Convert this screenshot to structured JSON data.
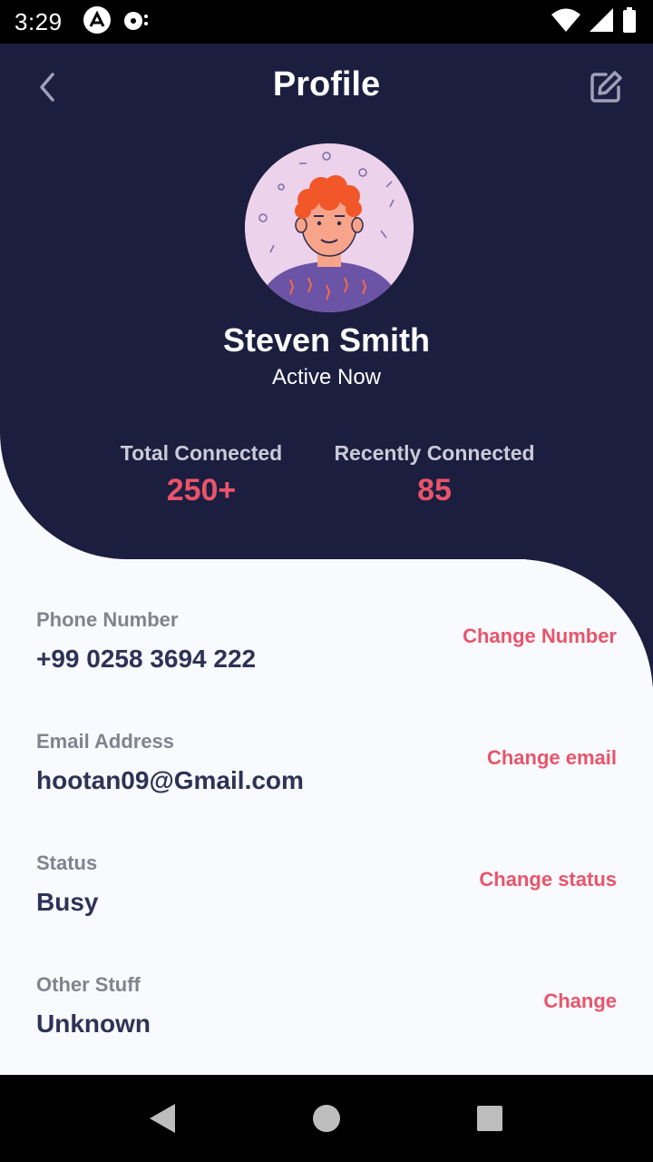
{
  "status_bar": {
    "time": "3:29",
    "icons": [
      "app-a-icon",
      "media-icon",
      "wifi-icon",
      "signal-icon",
      "battery-icon"
    ]
  },
  "header": {
    "title": "Profile",
    "back_icon": "chevron-left-icon",
    "edit_icon": "edit-icon"
  },
  "profile": {
    "name": "Steven Smith",
    "status": "Active Now",
    "avatar_icon": "avatar-illustration"
  },
  "stats": {
    "total_label": "Total Connected",
    "total_value": "250+",
    "recent_label": "Recently Connected",
    "recent_value": "85"
  },
  "info": [
    {
      "label": "Phone Number",
      "value": "+99 0258 3694 222",
      "action": "Change Number"
    },
    {
      "label": "Email Address",
      "value": "hootan09@Gmail.com",
      "action": "Change email"
    },
    {
      "label": "Status",
      "value": "Busy",
      "action": "Change status"
    },
    {
      "label": "Other Stuff",
      "value": "Unknown",
      "action": "Change"
    }
  ],
  "nav_bar": {
    "icons": [
      "back-triangle-icon",
      "home-circle-icon",
      "recents-square-icon"
    ]
  },
  "colors": {
    "header_bg": "#1b1e3f",
    "accent": "#e9546b",
    "body_bg": "#f8fafd",
    "value_text": "#2e3256"
  }
}
